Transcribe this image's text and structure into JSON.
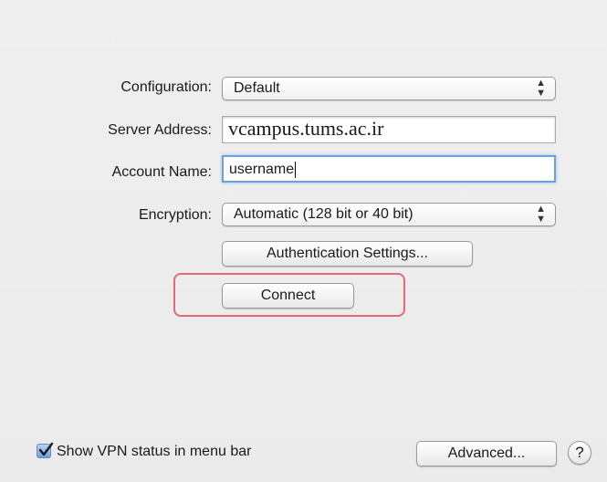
{
  "form": {
    "configuration": {
      "label": "Configuration:",
      "value": "Default"
    },
    "server_address": {
      "label": "Server Address:",
      "value": "vcampus.tums.ac.ir"
    },
    "account_name": {
      "label": "Account Name:",
      "value": "username"
    },
    "encryption": {
      "label": "Encryption:",
      "value": "Automatic (128 bit or 40 bit)"
    }
  },
  "buttons": {
    "authentication_settings": "Authentication Settings...",
    "connect": "Connect",
    "advanced": "Advanced...",
    "help": "?"
  },
  "footer": {
    "show_vpn_status_label": "Show VPN status in menu bar",
    "show_vpn_status_checked": true
  },
  "colors": {
    "highlight_border": "#e06a78",
    "focus_ring": "#6ea0dd",
    "checkbox_fill": "#6d9fdc"
  },
  "icons": {
    "select_arrows": "up-down-arrows-icon",
    "checkmark": "checkmark-icon"
  }
}
